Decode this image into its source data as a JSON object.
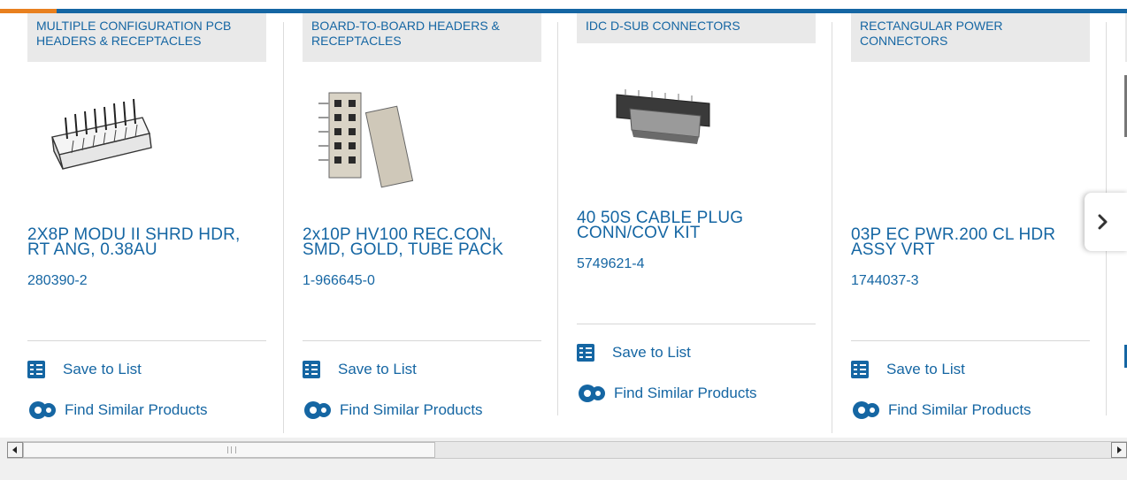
{
  "products": [
    {
      "category": "MULTIPLE CONFIGURATION PCB HEADERS & RECEPTACLES",
      "name": "2X8P MODU II SHRD HDR, RT ANG, 0.38AU",
      "part_number": "280390-2",
      "save_label": "Save to List",
      "similar_label": "Find Similar Products"
    },
    {
      "category": "BOARD-TO-BOARD HEADERS & RECEPTACLES",
      "name": "2x10P HV100 REC.CON, SMD, GOLD, TUBE PACK",
      "part_number": "1-966645-0",
      "save_label": "Save to List",
      "similar_label": "Find Similar Products"
    },
    {
      "category": "IDC D-SUB CONNECTORS",
      "name": "40 50S CABLE PLUG CONN/COV KIT",
      "part_number": "5749621-4",
      "save_label": "Save to List",
      "similar_label": "Find Similar Products"
    },
    {
      "category": "RECTANGULAR POWER CONNECTORS",
      "name": "03P EC PWR.200 CL HDR ASSY VRT",
      "part_number": "1744037-3",
      "save_label": "Save to List",
      "similar_label": "Find Similar Products"
    }
  ],
  "carousel": {
    "next_icon": "chevron-right-icon"
  },
  "colors": {
    "brand_blue": "#1566a3",
    "accent_orange": "#e8801f"
  }
}
